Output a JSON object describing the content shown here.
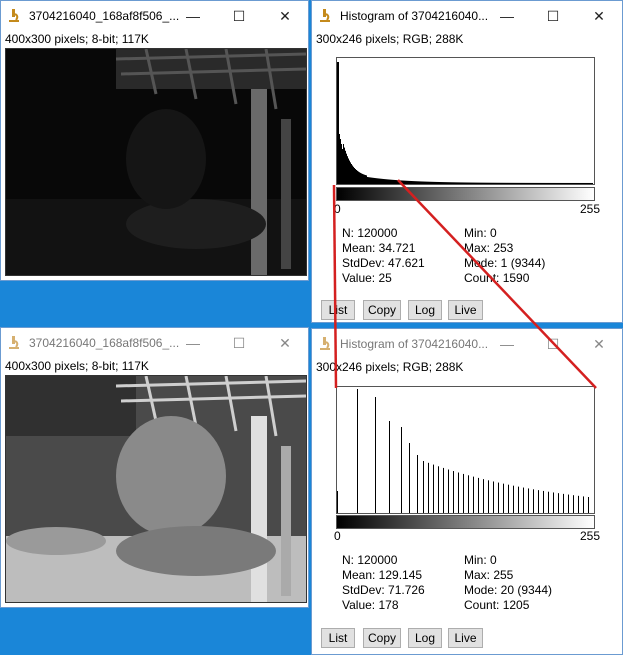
{
  "image_windows": [
    {
      "title": "3704216040_168af8f506_...",
      "info": "400x300 pixels; 8-bit; 117K",
      "controls": {
        "minimize": "—",
        "maximize": "☐",
        "close": "✕"
      }
    },
    {
      "title": "3704216040_168af8f506_...",
      "info": "400x300 pixels; 8-bit; 117K",
      "controls": {
        "minimize": "—",
        "maximize": "☐",
        "close": "✕"
      }
    }
  ],
  "histogram_windows": [
    {
      "title": "Histogram of 3704216040...",
      "info": "300x246 pixels; RGB; 288K",
      "axis_min": "0",
      "axis_max": "255",
      "stats": {
        "n": "N: 120000",
        "mean": "Mean: 34.721",
        "stddev": "StdDev: 47.621",
        "value": "Value: 25",
        "min": "Min: 0",
        "max": "Max: 253",
        "mode": "Mode: 1 (9344)",
        "count": "Count: 1590"
      },
      "buttons": [
        "List",
        "Copy",
        "Log",
        "Live"
      ],
      "controls": {
        "minimize": "—",
        "maximize": "☐",
        "close": "✕"
      }
    },
    {
      "title": "Histogram of 3704216040...",
      "info": "300x246 pixels; RGB; 288K",
      "axis_min": "0",
      "axis_max": "255",
      "stats": {
        "n": "N: 120000",
        "mean": "Mean: 129.145",
        "stddev": "StdDev: 71.726",
        "value": "Value: 178",
        "min": "Min: 0",
        "max": "Max: 255",
        "mode": "Mode: 20 (9344)",
        "count": "Count: 1205"
      },
      "buttons": [
        "List",
        "Copy",
        "Log",
        "Live"
      ],
      "controls": {
        "minimize": "—",
        "maximize": "☐",
        "close": "✕"
      }
    }
  ],
  "colors": {
    "desktop": "#1a86d8",
    "annotation_line": "#d42020"
  }
}
